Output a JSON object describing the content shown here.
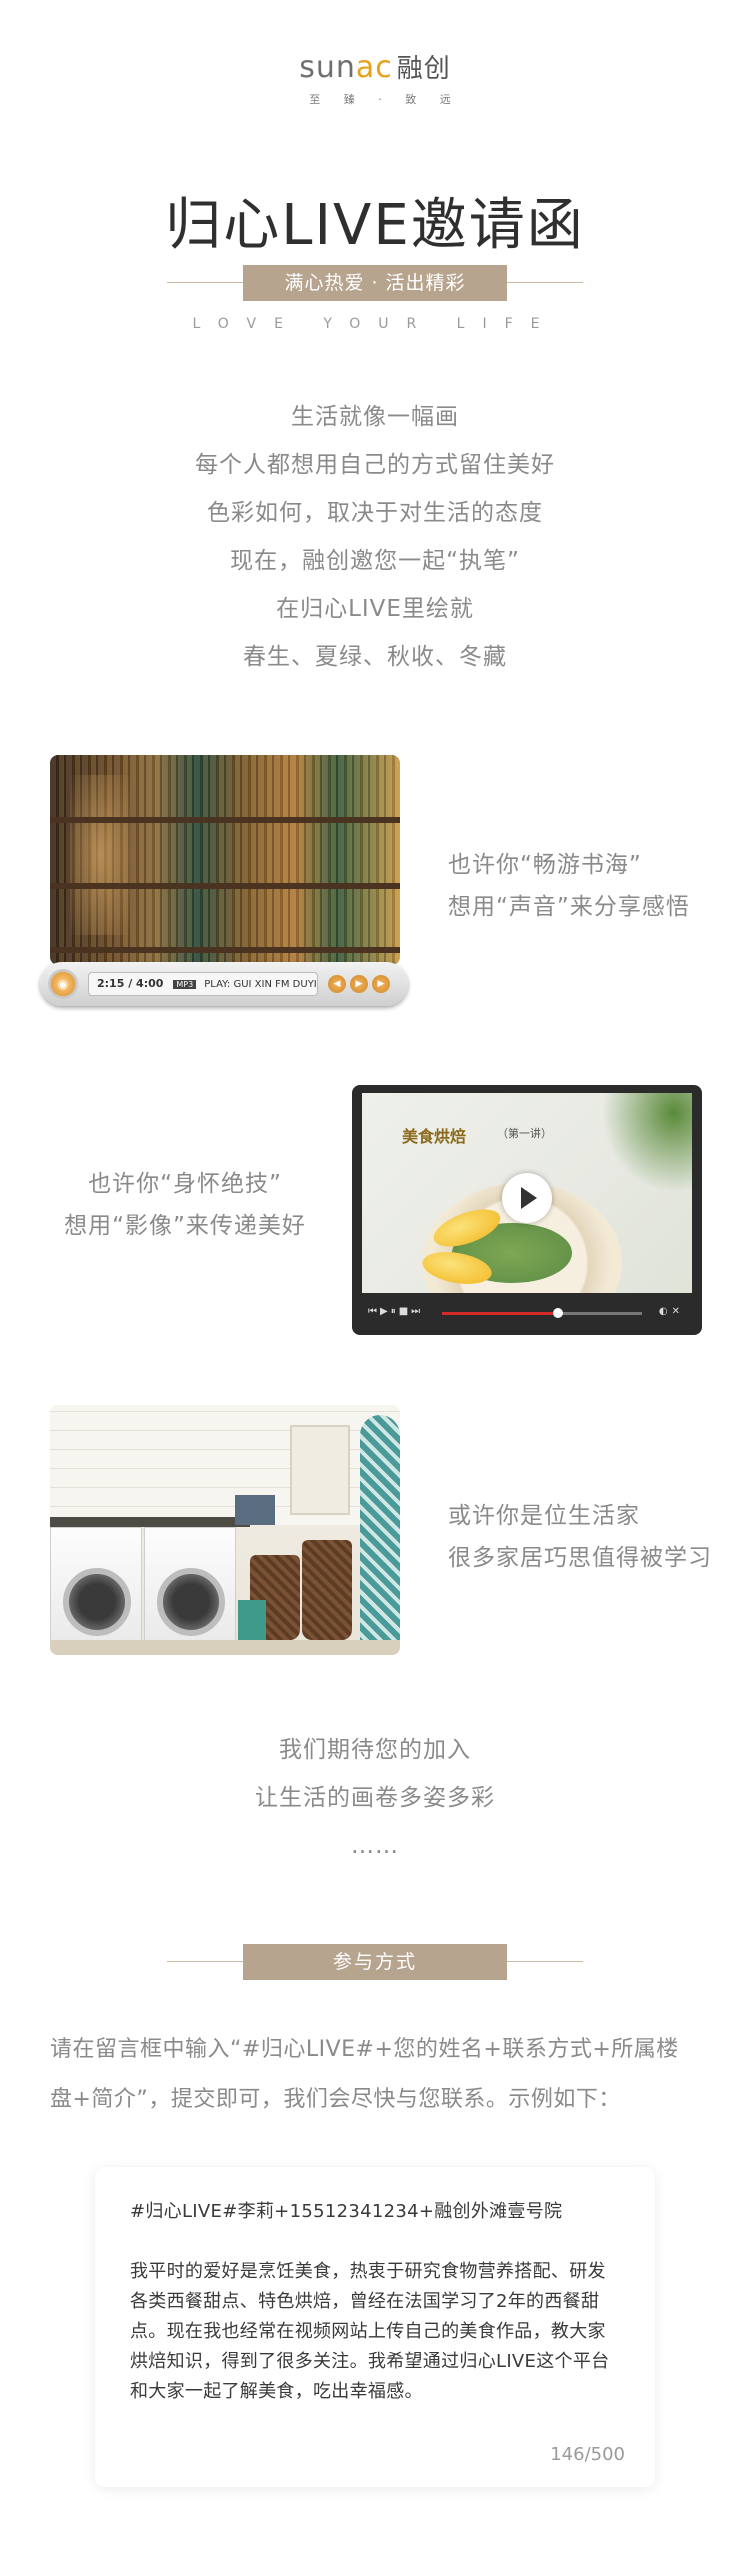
{
  "brand": {
    "logo_prefix": "sun",
    "logo_accent": "ac",
    "logo_cn": "融创",
    "tagline": "至 臻 · 致 远",
    "accent_color": "#e8a21a"
  },
  "header": {
    "title": "归心LIVE邀请函",
    "slogan": "满心热爱 · 活出精彩",
    "subtitle": "LOVE YOUR LIFE"
  },
  "poem": [
    "生活就像一幅画",
    "每个人都想用自己的方式留住美好",
    "色彩如何，取决于对生活的态度",
    "现在，融创邀您一起“执笔”",
    "在归心LIVE里绘就",
    "春生、夏绿、秋收、冬藏"
  ],
  "features": {
    "reading": {
      "line1": "也许你“畅游书海”",
      "line2": "想用“声音”来分享感悟"
    },
    "player": {
      "time": "2:15 / 4:00",
      "badge": "MP3",
      "track": "PLAY: GUI XIN FM DUYIBEN..."
    },
    "skill": {
      "line1": "也许你“身怀绝技”",
      "line2": "想用“影像”来传递美好"
    },
    "video": {
      "title": "美食烘焙",
      "episode": "（第一讲）",
      "progress": 0.58
    },
    "home": {
      "line1": "或许你是位生活家",
      "line2": "很多家居巧思值得被学习"
    }
  },
  "expect": [
    "我们期待您的加入",
    "让生活的画卷多姿多彩",
    "……"
  ],
  "participation": {
    "heading": "参与方式",
    "instruction": "请在留言框中输入“#归心LIVE#+您的姓名+联系方式+所属楼盘+简介”，提交即可，我们会尽快与您联系。示例如下：",
    "example_tag": "#归心LIVE#李莉+15512341234+融创外滩壹号院",
    "example_body": "我平时的爱好是烹饪美食，热衷于研究食物营养搭配、研发各类西餐甜点、特色烘焙，曾经在法国学习了2年的西餐甜点。现在我也经常在视频网站上传自己的美食作品，教大家烘焙知识，得到了很多关注。我希望通过归心LIVE这个平台和大家一起了解美食，吃出幸福感。",
    "char_count": "146/500"
  }
}
